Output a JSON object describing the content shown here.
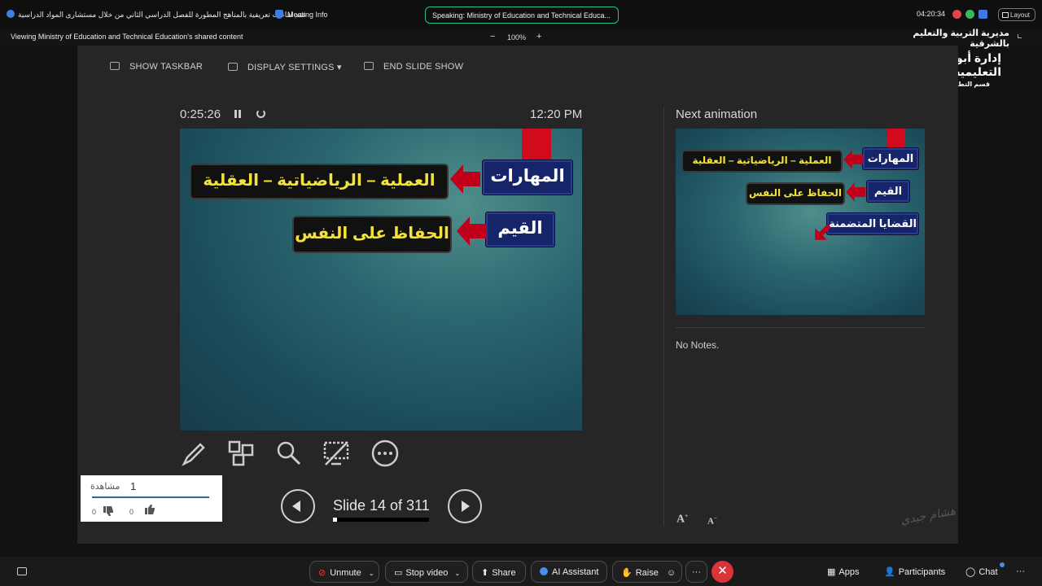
{
  "topbar": {
    "meeting_title": "عقد لقاءات تعريفية بالمناهج المطورة للفصل الدراسي الثاني من خلال مستشارى المواد الدراسية",
    "meeting_info": "Meeting Info",
    "speaking": "Speaking: Ministry of Education and Technical Educa...",
    "time": "04:20:34",
    "layout": "Layout"
  },
  "share_strip": {
    "viewing": "Viewing Ministry of Education and Technical Education's shared content",
    "zoom_minus": "−",
    "zoom_level": "100%",
    "zoom_plus": "+"
  },
  "logo": {
    "line1": "مديرية التربية والتعليم بالشرقية",
    "line2": "إدارة أبوكبير التعليمية",
    "line3": "قسم التطوير التكنولوجي"
  },
  "presenter": {
    "show_taskbar": "SHOW TASKBAR",
    "display_settings": "DISPLAY SETTINGS ▾",
    "end_slide_show": "END SLIDE SHOW",
    "elapsed": "0:25:26",
    "clock": "12:20 PM",
    "next_animation": "Next animation",
    "notes": "No Notes.",
    "slide_counter": "Slide 14 of 311",
    "slide_progress": 0.045
  },
  "slide": {
    "skills_label": "المهارات",
    "skills_value": "العملية – الرياضياتية – العقلية",
    "values_label": "القيم",
    "values_value": "الحفاظ على النفس"
  },
  "next_slide": {
    "skills_label": "المهارات",
    "skills_value": "العملية – الرياضياتية – العقلية",
    "values_label": "القيم",
    "values_value": "الحفاظ على النفس",
    "issues_label": "القضايا المتضمنة"
  },
  "views": {
    "count": "1",
    "label": "مشاهدة",
    "dislikes": "0",
    "likes": "0"
  },
  "watermark": "هشام جيدي",
  "bottombar": {
    "unmute": "Unmute",
    "stop_video": "Stop video",
    "share": "Share",
    "ai_assistant": "AI Assistant",
    "raise": "Raise",
    "more": "···",
    "apps": "Apps",
    "participants": "Participants",
    "chat": "Chat",
    "more_right": "···"
  },
  "colors": {
    "accent_green": "#27c38a",
    "end_red": "#d93437",
    "label_blue": "#16256a",
    "value_yellow": "#f2e23a",
    "arrow_red": "#c0001a"
  }
}
